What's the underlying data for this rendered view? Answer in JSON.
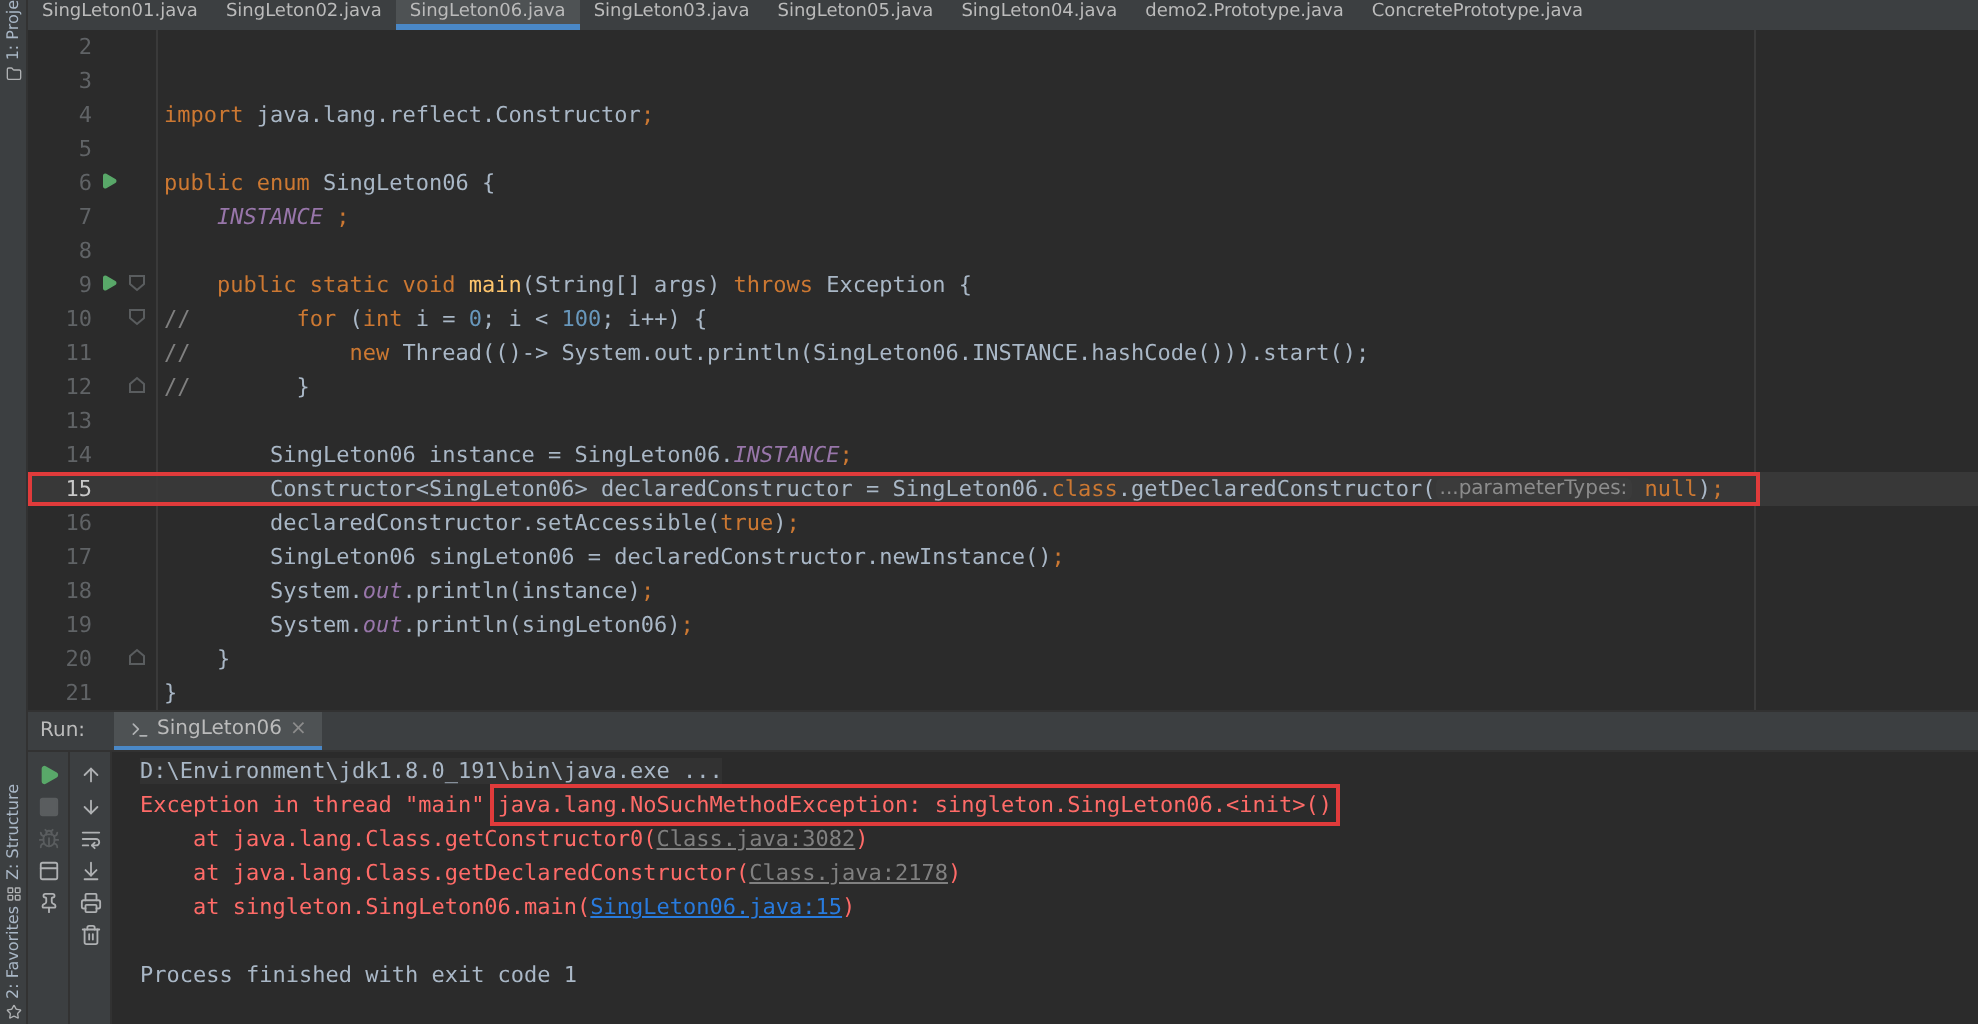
{
  "side_strip": [
    {
      "label": "1: Proje"
    },
    {
      "label": "Z: Structure"
    },
    {
      "label": "2: Favorites"
    }
  ],
  "tabs": [
    {
      "label": "SingLeton01.java",
      "selected": false
    },
    {
      "label": "SingLeton02.java",
      "selected": false
    },
    {
      "label": "SingLeton06.java",
      "selected": true
    },
    {
      "label": "SingLeton03.java",
      "selected": false
    },
    {
      "label": "SingLeton05.java",
      "selected": false
    },
    {
      "label": "SingLeton04.java",
      "selected": false
    },
    {
      "label": "demo2.Prototype.java",
      "selected": false
    },
    {
      "label": "ConcretePrototype.java",
      "selected": false
    }
  ],
  "editor": {
    "lines": [
      {
        "number": "2",
        "kind": "code",
        "current": false,
        "boxed": false
      },
      {
        "number": "3",
        "kind": "code",
        "current": false,
        "boxed": false
      },
      {
        "number": "4",
        "kind": "code",
        "current": false,
        "boxed": false,
        "tokens": [
          {
            "text": "import",
            "kind": "keyword"
          },
          {
            "text": " java.lang.reflect.Constructor",
            "kind": "plain"
          },
          {
            "text": ";",
            "kind": "keyword"
          }
        ]
      },
      {
        "number": "5",
        "kind": "code",
        "current": false,
        "boxed": false
      },
      {
        "number": "6",
        "kind": "run",
        "current": false,
        "boxed": false,
        "tokens": [
          {
            "text": "public enum ",
            "kind": "keyword"
          },
          {
            "text": "SingLeton06 {",
            "kind": "plain"
          }
        ]
      },
      {
        "number": "7",
        "kind": "code",
        "current": false,
        "boxed": false,
        "tokens": [
          {
            "text": "    INSTANCE",
            "kind": "static"
          },
          {
            "text": " ;",
            "kind": "keyword"
          }
        ]
      },
      {
        "number": "8",
        "kind": "code",
        "current": false,
        "boxed": false
      },
      {
        "number": "9",
        "kind": "run_fold",
        "current": false,
        "boxed": false,
        "tokens": [
          {
            "text": "    public static void ",
            "kind": "keyword"
          },
          {
            "text": "main",
            "kind": "method"
          },
          {
            "text": "(String[] args) ",
            "kind": "plain"
          },
          {
            "text": "throws ",
            "kind": "keyword"
          },
          {
            "text": "Exception {",
            "kind": "plain"
          }
        ]
      },
      {
        "number": "10",
        "kind": "fold_start",
        "current": false,
        "boxed": false,
        "tokens": [
          {
            "text": "//",
            "kind": "comment"
          },
          {
            "text": "        for ",
            "kind": "keyword"
          },
          {
            "text": "(",
            "kind": "plain"
          },
          {
            "text": "int ",
            "kind": "keyword"
          },
          {
            "text": "i = ",
            "kind": "plain"
          },
          {
            "text": "0",
            "kind": "number"
          },
          {
            "text": "; i < ",
            "kind": "plain"
          },
          {
            "text": "100",
            "kind": "number"
          },
          {
            "text": "; i++) {",
            "kind": "plain"
          }
        ]
      },
      {
        "number": "11",
        "kind": "code",
        "current": false,
        "boxed": false,
        "tokens": [
          {
            "text": "//",
            "kind": "comment"
          },
          {
            "text": "            new ",
            "kind": "keyword"
          },
          {
            "text": "Thread(()-> System.out.println(SingLeton06.INSTANCE.hashCode())).start();",
            "kind": "plain"
          }
        ]
      },
      {
        "number": "12",
        "kind": "fold_end",
        "current": false,
        "boxed": false,
        "tokens": [
          {
            "text": "//",
            "kind": "comment"
          },
          {
            "text": "        }",
            "kind": "plain"
          }
        ]
      },
      {
        "number": "13",
        "kind": "code",
        "current": false,
        "boxed": false
      },
      {
        "number": "14",
        "kind": "code",
        "current": false,
        "boxed": false,
        "tokens": [
          {
            "text": "        SingLeton06 instance = SingLeton06.",
            "kind": "plain"
          },
          {
            "text": "INSTANCE",
            "kind": "static"
          },
          {
            "text": ";",
            "kind": "keyword"
          }
        ]
      },
      {
        "number": "15",
        "kind": "code",
        "current": true,
        "boxed": true,
        "tokens": [
          {
            "text": "        Constructor<SingLeton06> declaredConstructor = SingLeton06.",
            "kind": "plain"
          },
          {
            "text": "class",
            "kind": "keyword"
          },
          {
            "text": ".getDeclaredConstructor(",
            "kind": "plain"
          },
          {
            "text": "...parameterTypes:",
            "kind": "hint"
          },
          {
            "text": " null",
            "kind": "keyword"
          },
          {
            "text": ")",
            "kind": "plain"
          },
          {
            "text": ";",
            "kind": "keyword"
          }
        ]
      },
      {
        "number": "16",
        "kind": "code",
        "current": false,
        "boxed": false,
        "tokens": [
          {
            "text": "        declaredConstructor.setAccessible(",
            "kind": "plain"
          },
          {
            "text": "true",
            "kind": "keyword"
          },
          {
            "text": ")",
            "kind": "plain"
          },
          {
            "text": ";",
            "kind": "keyword"
          }
        ]
      },
      {
        "number": "17",
        "kind": "code",
        "current": false,
        "boxed": false,
        "tokens": [
          {
            "text": "        SingLeton06 singLeton06 = declaredConstructor.newInstance()",
            "kind": "plain"
          },
          {
            "text": ";",
            "kind": "keyword"
          }
        ]
      },
      {
        "number": "18",
        "kind": "code",
        "current": false,
        "boxed": false,
        "tokens": [
          {
            "text": "        System.",
            "kind": "plain"
          },
          {
            "text": "out",
            "kind": "static"
          },
          {
            "text": ".println(instance)",
            "kind": "plain"
          },
          {
            "text": ";",
            "kind": "keyword"
          }
        ]
      },
      {
        "number": "19",
        "kind": "code",
        "current": false,
        "boxed": false,
        "tokens": [
          {
            "text": "        System.",
            "kind": "plain"
          },
          {
            "text": "out",
            "kind": "static"
          },
          {
            "text": ".println(singLeton06)",
            "kind": "plain"
          },
          {
            "text": ";",
            "kind": "keyword"
          }
        ]
      },
      {
        "number": "20",
        "kind": "fold_end",
        "current": false,
        "boxed": false,
        "tokens": [
          {
            "text": "    }",
            "kind": "plain"
          }
        ]
      },
      {
        "number": "21",
        "kind": "code",
        "current": false,
        "boxed": false,
        "tokens": [
          {
            "text": "}",
            "kind": "plain"
          }
        ]
      }
    ]
  },
  "run_panel": {
    "title": "Run:",
    "tab": {
      "label": "SingLeton06",
      "close": "×",
      "selected": true
    },
    "tools": [
      {
        "disabled": false
      },
      {
        "disabled": true
      },
      {
        "disabled": true
      },
      {
        "disabled": false
      },
      {
        "disabled": false
      }
    ],
    "tools_2": [
      {
        "disabled": false
      },
      {
        "disabled": false
      },
      {
        "disabled": false
      },
      {
        "disabled": false
      },
      {
        "disabled": false
      },
      {
        "disabled": false
      }
    ],
    "console": [
      {
        "kind": "output",
        "tokens": [
          {
            "text": "D:\\Environment\\jdk1.8.0_191\\bin\\java.exe ...",
            "kind": "command"
          }
        ]
      },
      {
        "kind": "output",
        "tokens": [
          {
            "text": "Exception in thread \"main\" ",
            "kind": "error"
          },
          {
            "text": "java.lang.NoSuchMethodException: singleton.SingLeton06.<init>()",
            "kind": "error_boxed"
          }
        ]
      },
      {
        "kind": "output",
        "tokens": [
          {
            "text": "    at java.lang.Class.getConstructor0(",
            "kind": "error"
          },
          {
            "text": "Class.java:3082",
            "kind": "muted_link"
          },
          {
            "text": ")",
            "kind": "error"
          }
        ]
      },
      {
        "kind": "output",
        "tokens": [
          {
            "text": "    at java.lang.Class.getDeclaredConstructor(",
            "kind": "error"
          },
          {
            "text": "Class.java:2178",
            "kind": "muted_link"
          },
          {
            "text": ")",
            "kind": "error"
          }
        ]
      },
      {
        "kind": "output",
        "tokens": [
          {
            "text": "    at singleton.SingLeton06.main(",
            "kind": "error"
          },
          {
            "text": "SingLeton06.java:15",
            "kind": "link"
          },
          {
            "text": ")",
            "kind": "error"
          }
        ]
      },
      {
        "kind": "summary",
        "tokens": [
          {
            "text": "Process finished with exit code 1",
            "kind": "plain"
          }
        ]
      }
    ]
  }
}
